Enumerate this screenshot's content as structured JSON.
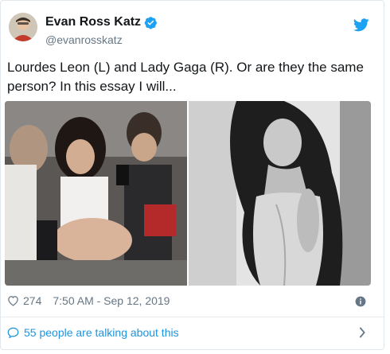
{
  "author": {
    "name": "Evan Ross Katz",
    "handle": "@evanrosskatz",
    "verified": true,
    "avatar_icon": "user-avatar"
  },
  "tweet": {
    "text": "Lourdes Leon (L) and Lady Gaga (R). Or are they the same person? In this essay I will...",
    "media": [
      {
        "alt_icon": "photo-left",
        "position": "left"
      },
      {
        "alt_icon": "photo-right",
        "position": "right"
      }
    ]
  },
  "footer": {
    "likes": "274",
    "timestamp": "7:50 AM - Sep 12, 2019",
    "conversation": "55 people are talking about this"
  },
  "colors": {
    "brand": "#1da1f2",
    "link": "#1b95e0",
    "muted": "#657786",
    "text": "#14171a"
  }
}
